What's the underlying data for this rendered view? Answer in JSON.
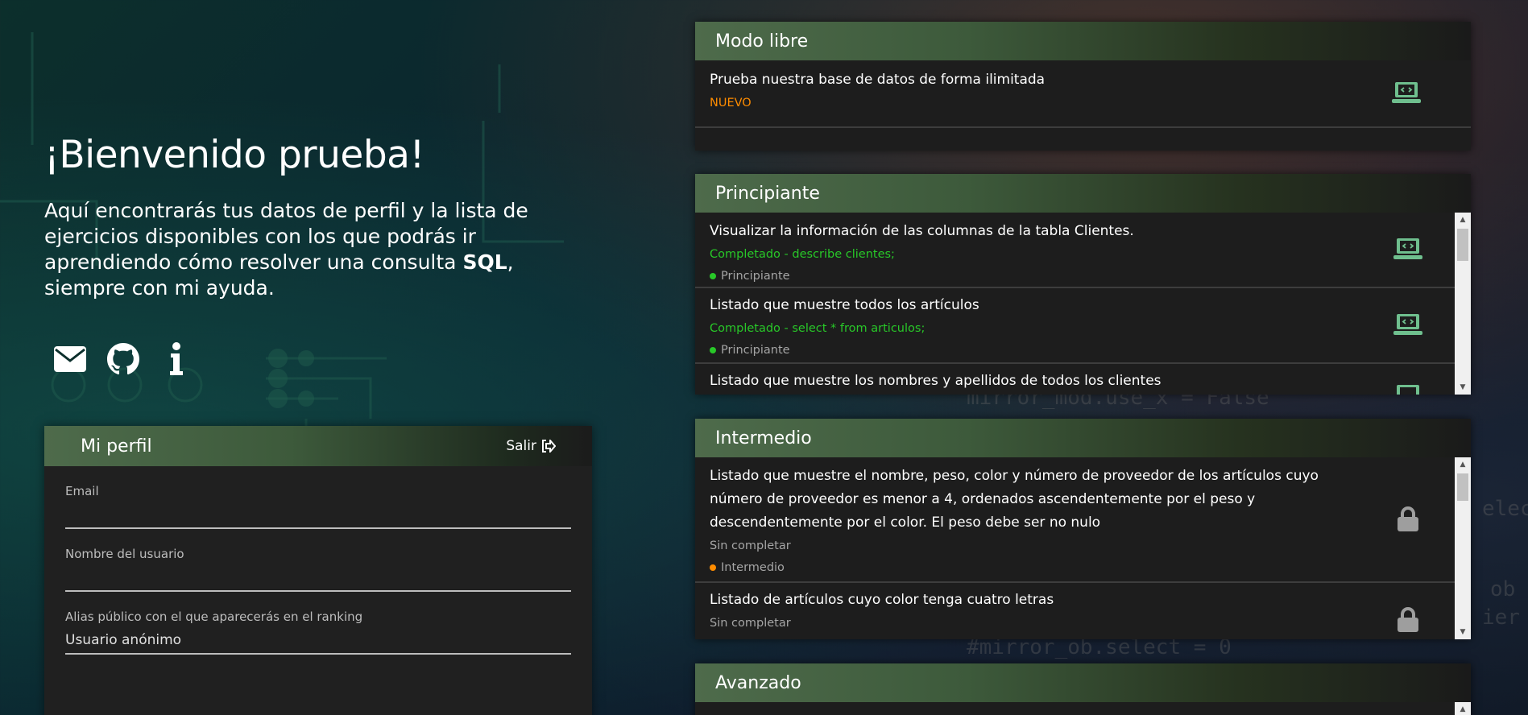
{
  "welcome": {
    "title": "¡Bienvenido prueba!",
    "text_before": "Aquí encontrarás tus datos de perfil y la lista de ejercicios disponibles con los que podrás ir aprendiendo cómo resolver una consulta ",
    "text_bold": "SQL",
    "text_after": ", siempre con mi ayuda."
  },
  "social": {
    "icons": [
      "envelope-icon",
      "github-icon",
      "info-icon"
    ]
  },
  "profile": {
    "title": "Mi perfil",
    "logout_label": "Salir",
    "email_label": "Email",
    "email_value": "",
    "username_label": "Nombre del usuario",
    "username_value": "",
    "alias_label": "Alias público con el que aparecerás en el ranking",
    "alias_value": "Usuario anónimo"
  },
  "sections": {
    "free": {
      "title": "Modo libre",
      "items": [
        {
          "title": "Prueba nuestra base de datos de forma ilimitada",
          "status": "NUEVO"
        }
      ]
    },
    "beginner": {
      "title": "Principiante",
      "items": [
        {
          "title": "Visualizar la información de las columnas de la tabla Clientes.",
          "status": "Completado - describe clientes;",
          "level": "Principiante"
        },
        {
          "title": "Listado que muestre todos los artículos",
          "status": "Completado - select * from articulos;",
          "level": "Principiante"
        },
        {
          "title": "Listado que muestre los nombres y apellidos de todos los clientes",
          "status": "",
          "level": ""
        }
      ]
    },
    "intermediate": {
      "title": "Intermedio",
      "items": [
        {
          "title": "Listado que muestre el nombre, peso, color y número de proveedor de los artículos cuyo número de proveedor es menor a 4, ordenados ascendentemente por el peso y descendentemente por el color. El peso debe ser no nulo",
          "status": "Sin completar",
          "level": "Intermedio"
        },
        {
          "title": "Listado de artículos cuyo color tenga cuatro letras",
          "status": "Sin completar",
          "level": ""
        }
      ]
    },
    "advanced": {
      "title": "Avanzado"
    }
  },
  "colors": {
    "completed": "#28c828",
    "new": "#ff8c00",
    "intermediate_dot": "#ff8c00",
    "beginner_dot": "#28c828",
    "icon_green": "#6fbf8e"
  }
}
